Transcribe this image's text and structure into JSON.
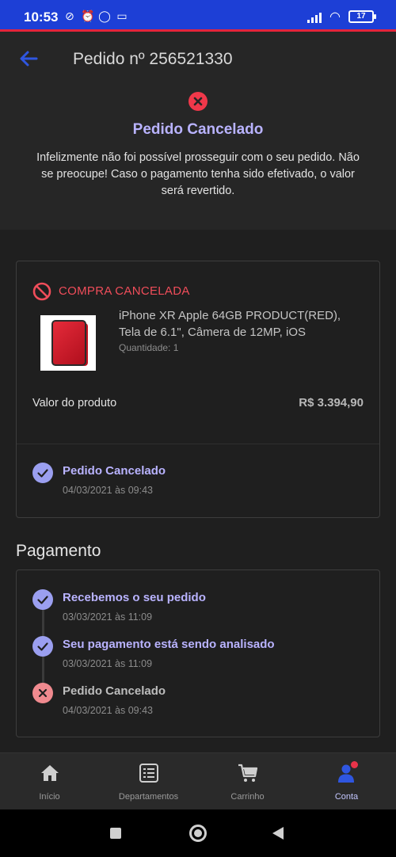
{
  "status_bar": {
    "time": "10:53",
    "battery": "17"
  },
  "header": {
    "title": "Pedido nº 256521330",
    "status_title": "Pedido Cancelado",
    "status_message": "Infelizmente não foi possível prosseguir com o seu pedido. Não se preocupe! Caso o pagamento tenha sido efetivado, o valor será revertido."
  },
  "product_card": {
    "badge": "COMPRA CANCELADA",
    "product_name": "iPhone XR Apple 64GB PRODUCT(RED), Tela de 6.1\", Câmera de 12MP, iOS",
    "quantity": "Quantidade: 1",
    "price_label": "Valor do produto",
    "price_value": "R$ 3.394,90",
    "step": {
      "title": "Pedido Cancelado",
      "date": "04/03/2021 às 09:43"
    }
  },
  "payment": {
    "section_title": "Pagamento",
    "steps": [
      {
        "title": "Recebemos o seu pedido",
        "date": "03/03/2021 às 11:09",
        "state": "done"
      },
      {
        "title": "Seu pagamento está sendo analisado",
        "date": "03/03/2021 às 11:09",
        "state": "done"
      },
      {
        "title": "Pedido Cancelado",
        "date": "04/03/2021 às 09:43",
        "state": "cancelled"
      }
    ]
  },
  "bottom_nav": {
    "items": [
      {
        "label": "Início",
        "icon": "home-icon"
      },
      {
        "label": "Departamentos",
        "icon": "list-icon"
      },
      {
        "label": "Carrinho",
        "icon": "cart-icon"
      },
      {
        "label": "Conta",
        "icon": "user-icon"
      }
    ],
    "active": "Conta"
  },
  "colors": {
    "accent": "#b9b3ff",
    "danger": "#f04d5a",
    "status_bar": "#1d3fd6",
    "background": "#1f1f1f"
  }
}
